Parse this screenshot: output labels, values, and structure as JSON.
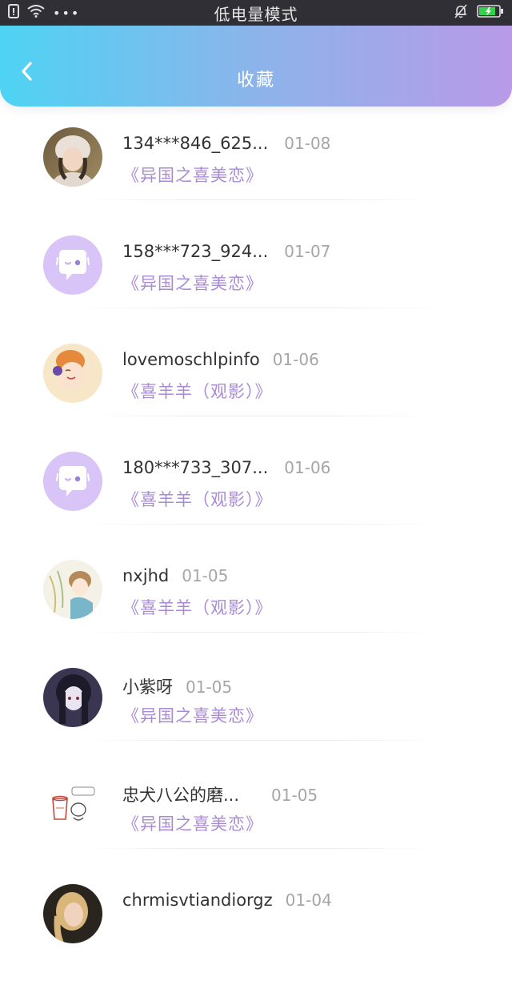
{
  "status_bar": {
    "title": "低电量模式",
    "dots": "•••"
  },
  "header": {
    "title": "收藏"
  },
  "items": [
    {
      "name": "134***846_625...",
      "date": "01-08",
      "subtitle": "《异国之喜美恋》",
      "avatar": "photo-girl"
    },
    {
      "name": "158***723_924...",
      "date": "01-07",
      "subtitle": "《异国之喜美恋》",
      "avatar": "default"
    },
    {
      "name": "lovemoschlpinfo",
      "date": "01-06",
      "subtitle": "《喜羊羊（观影）》",
      "avatar": "cartoon-girl"
    },
    {
      "name": "180***733_307...",
      "date": "01-06",
      "subtitle": "《喜羊羊（观影）》",
      "avatar": "default"
    },
    {
      "name": "nxjhd",
      "date": "01-05",
      "subtitle": "《喜羊羊（观影）》",
      "avatar": "anime-sketch"
    },
    {
      "name": "小紫呀",
      "date": "01-05",
      "subtitle": "《异国之喜美恋》",
      "avatar": "anime-dark"
    },
    {
      "name": "忠犬八公的磨...",
      "date": "01-05",
      "subtitle": "《异国之喜美恋》",
      "avatar": "doodle-cup"
    },
    {
      "name": "chrmisvtiandiorgz",
      "date": "01-04",
      "subtitle": "",
      "avatar": "photo-blonde"
    }
  ],
  "colors": {
    "accent_purple": "#a98ad6",
    "default_avatar_bg": "#d8c4f6",
    "header_gradient_start": "#4ed3f4",
    "header_gradient_end": "#b89ae8"
  }
}
